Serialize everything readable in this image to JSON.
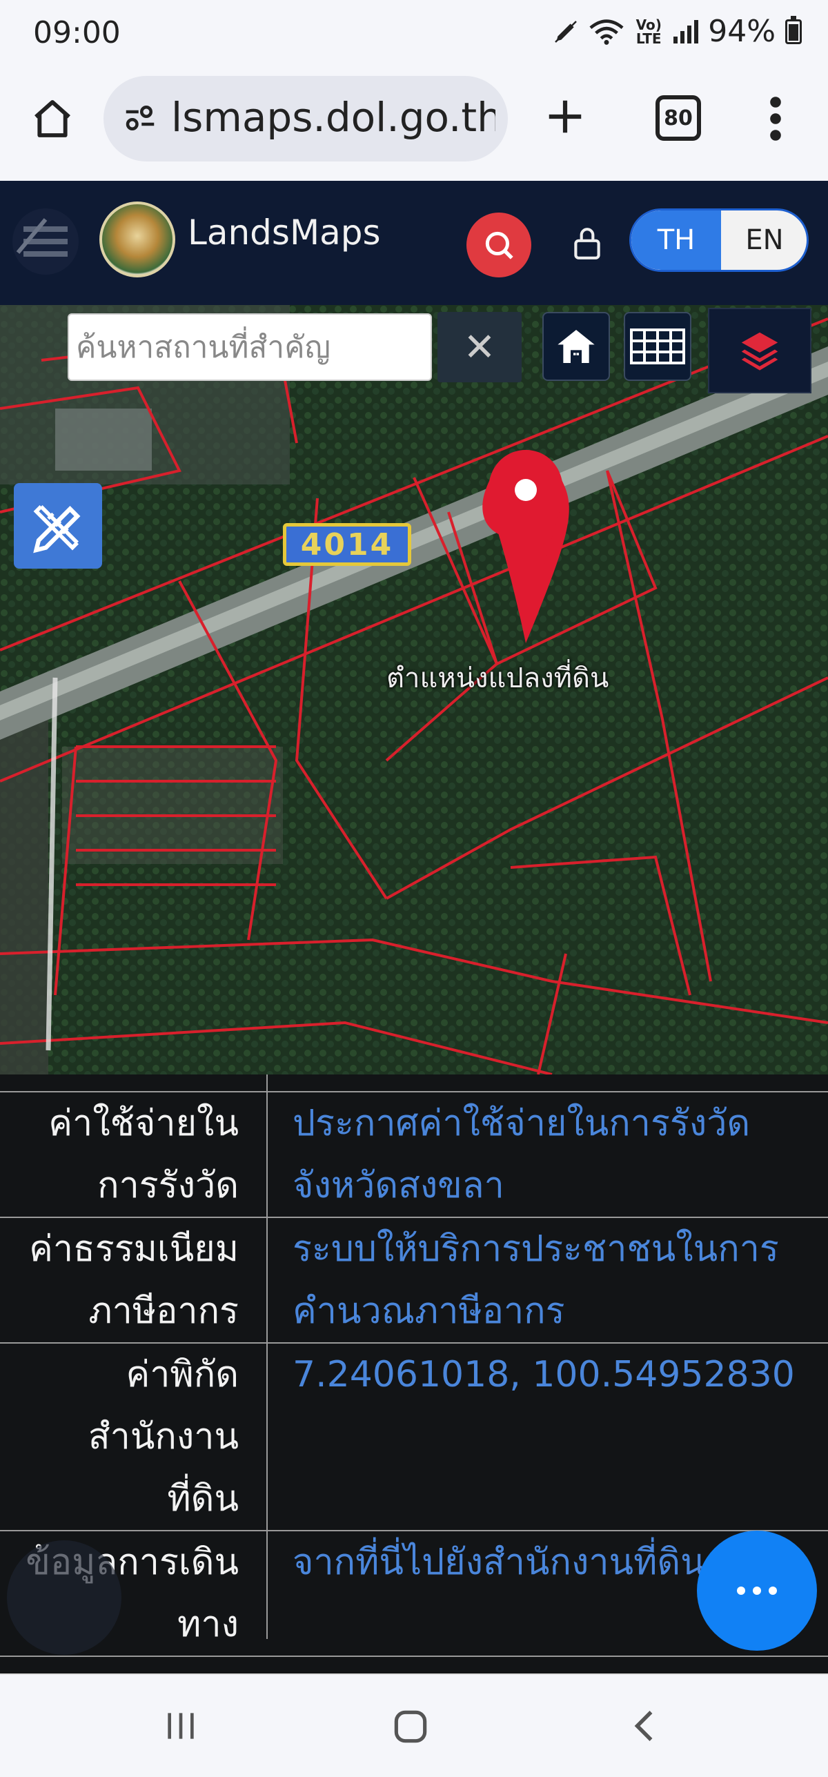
{
  "status_bar": {
    "time": "09:00",
    "network": "Vo) LTE",
    "battery": "94%"
  },
  "browser": {
    "url": "lsmaps.dol.go.th",
    "tab_count": "80"
  },
  "app": {
    "brand": "LandsMaps",
    "lang_th": "TH",
    "lang_en": "EN"
  },
  "map": {
    "search_placeholder": "ค้นหาสถานที่สำคัญ",
    "clear_label": "✕",
    "road_label": "4014",
    "pin_label": "ตำแหน่งแปลงที่ดิน"
  },
  "info_rows": [
    {
      "label_1": "ค่าใช้จ่ายใน",
      "label_2": "การรังวัด",
      "value_1": "ประกาศค่าใช้จ่ายในการรังวัด",
      "value_2": "จังหวัดสงขลา"
    },
    {
      "label_1": "ค่าธรรมเนียม",
      "label_2": "ภาษีอากร",
      "value_1": "ระบบให้บริการประชาชนในการ",
      "value_2": "คำนวณภาษีอากร"
    },
    {
      "label_1": "ค่าพิกัด",
      "label_2": "สำนักงาน",
      "label_3": "ที่ดิน",
      "value_1": "7.24061018, 100.54952830"
    },
    {
      "label_1": "ข้อมูลการเดิน",
      "label_2": "ทาง",
      "value_1": "จากที่นี่ไปยังสำนักงานที่ดิน"
    }
  ],
  "colors": {
    "header_bg": "#0e1a33",
    "accent_red": "#e03a40",
    "link_blue": "#4a86db",
    "fab_blue": "#1181f5"
  }
}
